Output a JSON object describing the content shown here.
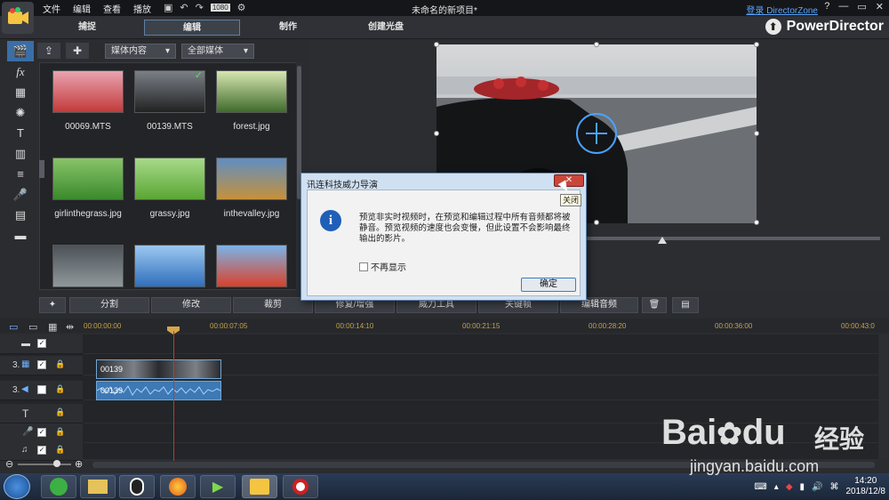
{
  "menu": [
    "文件",
    "编辑",
    "查看",
    "播放"
  ],
  "window_title": "未命名的新项目*",
  "login_link": "登录 DirectorZone",
  "title_controls": [
    "?",
    "—",
    "▭",
    "✕"
  ],
  "modes": [
    "捕捉",
    "编辑",
    "制作",
    "创建光盘"
  ],
  "brand": "PowerDirector",
  "library": {
    "filter_type": "媒体内容",
    "filter_media": "全部媒体",
    "items": [
      {
        "name": "00069.MTS",
        "colors": [
          "#c23a3a",
          "#e9a3b0"
        ]
      },
      {
        "name": "00139.MTS",
        "colors": [
          "#222222",
          "#7a7f87"
        ]
      },
      {
        "name": "forest.jpg",
        "colors": [
          "#3f6b2b",
          "#d6e6b0"
        ]
      },
      {
        "name": "girlinthegrass.jpg",
        "colors": [
          "#3b8a2c",
          "#89c46a"
        ]
      },
      {
        "name": "grassy.jpg",
        "colors": [
          "#5aa634",
          "#a7d98a"
        ]
      },
      {
        "name": "inthevalley.jpg",
        "colors": [
          "#c7913a",
          "#5f8ec2"
        ]
      },
      {
        "name": "",
        "colors": [
          "#8f989c",
          "#4d5257"
        ]
      },
      {
        "name": "",
        "colors": [
          "#2f6fbd",
          "#9cc8ef"
        ]
      },
      {
        "name": "",
        "colors": [
          "#d9412a",
          "#7bb4e8"
        ]
      }
    ]
  },
  "edit_buttons": [
    "分割",
    "修改",
    "裁剪",
    "修复/增强",
    "威力工具",
    "关键帧",
    "编辑音频"
  ],
  "timeline": {
    "ticks": [
      "00:00:00:00",
      "00:00:07:05",
      "00:00:14:10",
      "00:00:21:15",
      "00:00:28:20",
      "00:00:36:00",
      "00:00:43:0"
    ],
    "track_labels": [
      "",
      "3.",
      "3.",
      "",
      "",
      ""
    ],
    "clip_video": "00139",
    "clip_audio": "00139"
  },
  "dialog": {
    "title": "讯连科技威力导演",
    "message": "预览非实时视频时，在预览和编辑过程中所有音频都将被静音。预览视频的速度也会变慢，但此设置不会影响最终输出的影片。",
    "checkbox": "不再显示",
    "ok": "确定",
    "close_tooltip": "关闭"
  },
  "taskbar": {
    "time": "14:20",
    "date": "2018/12/8"
  },
  "watermark": {
    "brand": "Bai",
    "brand2": "du",
    "word": "经验",
    "url": "jingyan.baidu.com"
  }
}
